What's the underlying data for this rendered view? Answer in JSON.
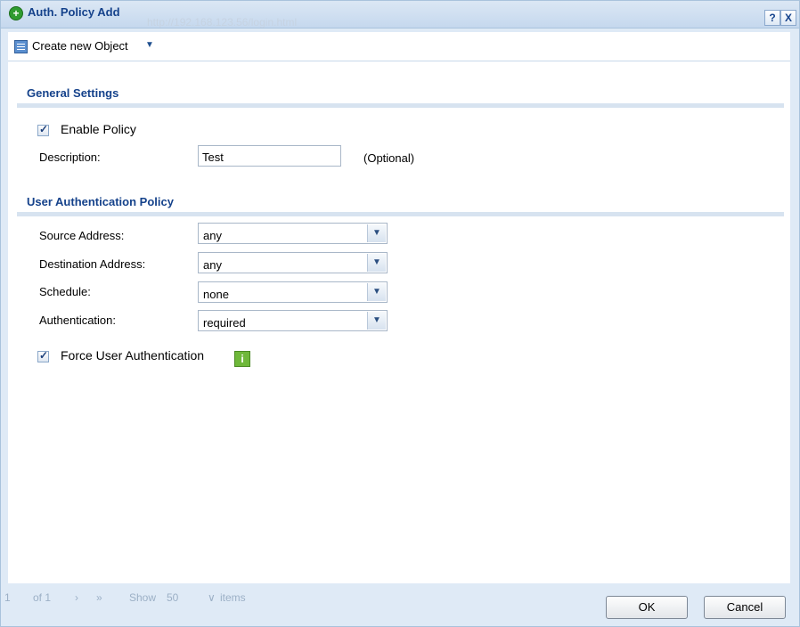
{
  "window": {
    "title": "Auth. Policy Add",
    "background_url": "http://192.168.123.56/login.html",
    "help_label": "?",
    "close_label": "X"
  },
  "toolbar": {
    "create_label": "Create new Object"
  },
  "general": {
    "title": "General Settings",
    "enable_label": "Enable Policy",
    "enable_checked": true,
    "description_label": "Description:",
    "description_value": "Test",
    "optional_label": "(Optional)"
  },
  "auth_policy": {
    "title": "User Authentication Policy",
    "fields": [
      {
        "label": "Source Address:",
        "value": "any"
      },
      {
        "label": "Destination Address:",
        "value": "any"
      },
      {
        "label": "Schedule:",
        "value": "none"
      },
      {
        "label": "Authentication:",
        "value": "required"
      }
    ],
    "force_label": "Force User Authentication",
    "force_checked": true
  },
  "pager": {
    "page": "1",
    "of_label": "of 1",
    "show_label": "Show",
    "per_page": "50",
    "items_label": "items"
  },
  "buttons": {
    "ok": "OK",
    "cancel": "Cancel"
  },
  "colors": {
    "title_text": "#15428b",
    "section_rule": "#d7e3f0",
    "frame_bg": "#dfeaf6"
  }
}
